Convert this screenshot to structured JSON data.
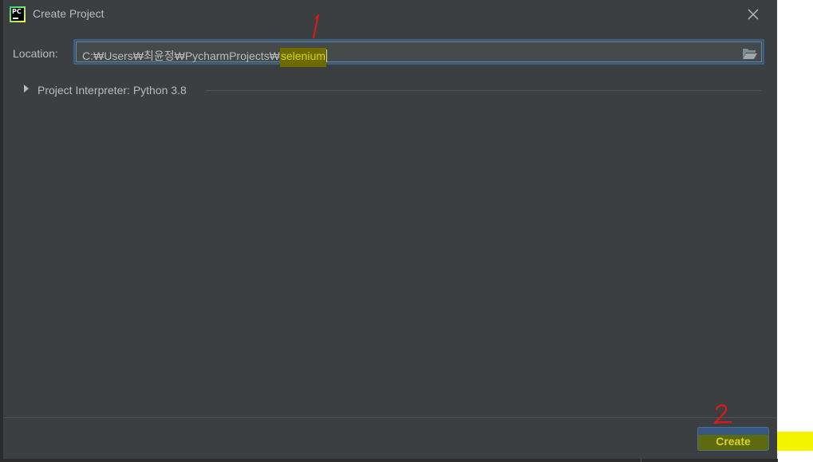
{
  "window": {
    "title": "Create Project",
    "app_icon_text": "PC"
  },
  "location": {
    "label": "Location:",
    "value_prefix": "C:₩Users₩최윤정₩PycharmProjects₩",
    "value_highlight": "selenium"
  },
  "interpreter": {
    "label": "Project Interpreter: Python 3.8"
  },
  "footer": {
    "create_label": "Create"
  },
  "annotations": {
    "mark_1": "1",
    "mark_2": "2"
  },
  "colors": {
    "dialog_bg": "#3c3f41",
    "text": "#bbbbbb",
    "focus_border": "#3d6185",
    "button_bg": "#365880",
    "highlight_yellow": "#f4f400",
    "annotation_red": "#e01818"
  },
  "icons": {
    "app": "pycharm-icon",
    "close": "close-icon",
    "browse": "folder-open-icon",
    "expand": "triangle-right-icon"
  }
}
